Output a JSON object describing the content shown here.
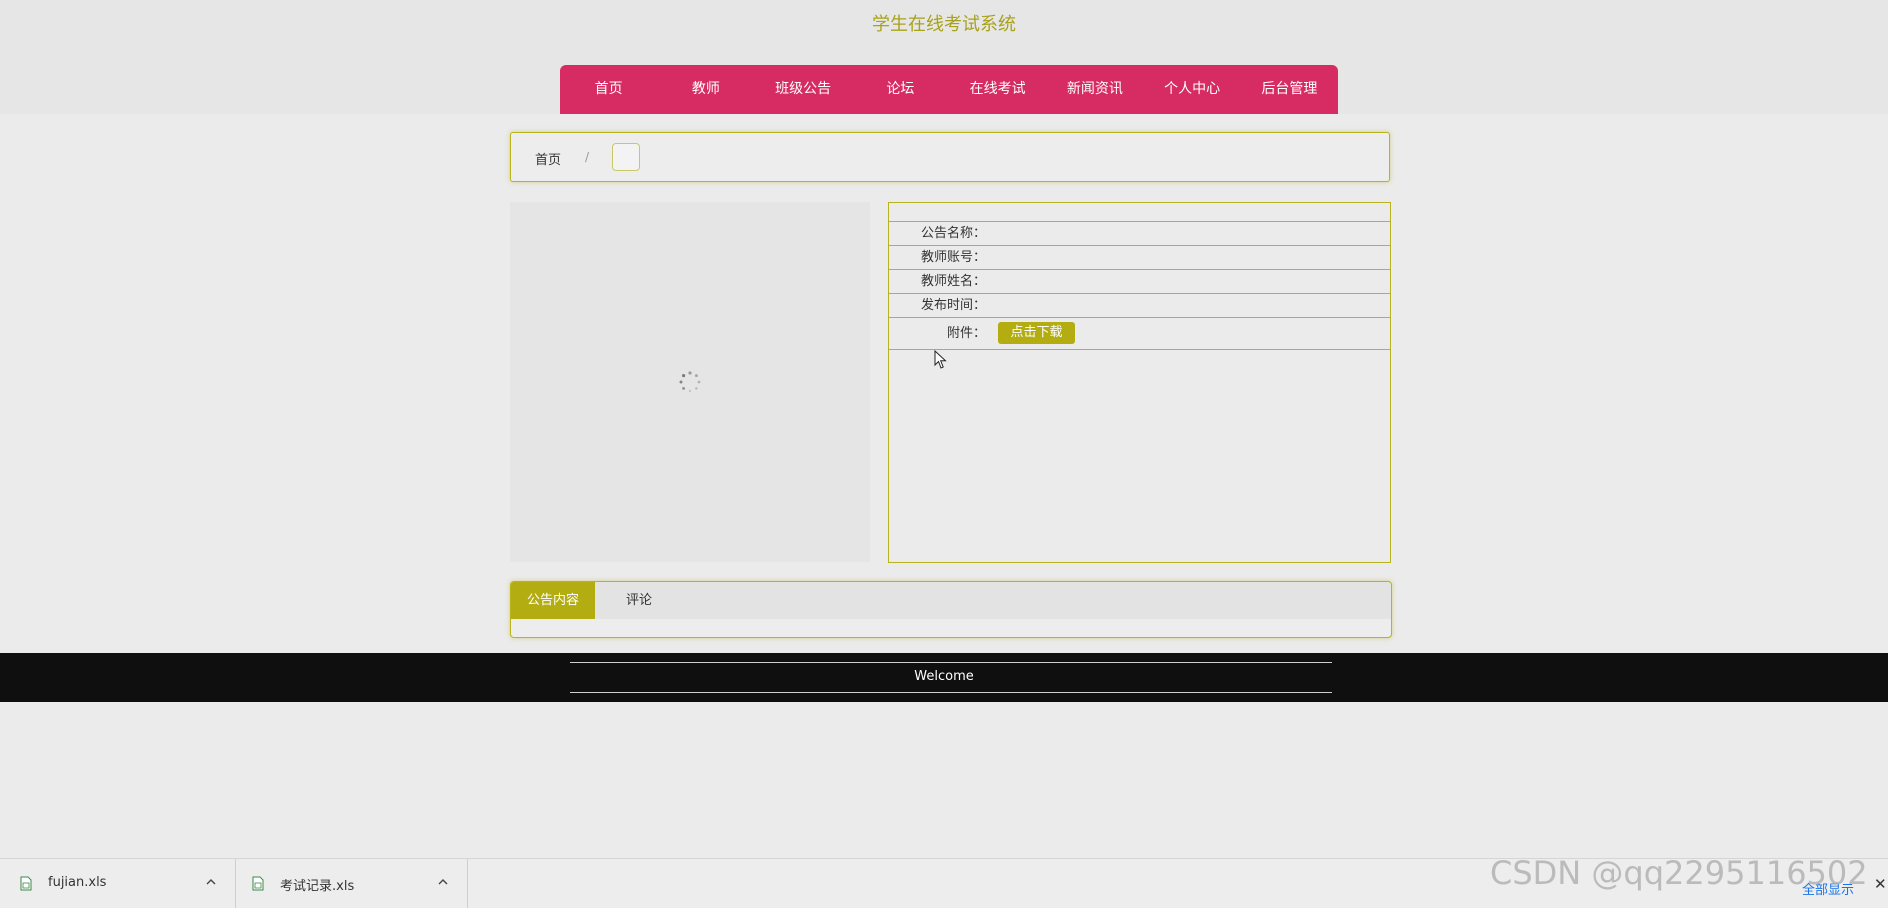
{
  "header": {
    "title": "学生在线考试系统"
  },
  "nav": {
    "items": [
      {
        "label": "首页"
      },
      {
        "label": "教师"
      },
      {
        "label": "班级公告"
      },
      {
        "label": "论坛"
      },
      {
        "label": "在线考试"
      },
      {
        "label": "新闻资讯"
      },
      {
        "label": "个人中心"
      },
      {
        "label": "后台管理"
      }
    ]
  },
  "breadcrumb": {
    "home": "首页",
    "separator": "/",
    "current": ""
  },
  "details": {
    "rows": [
      {
        "label": "公告名称：",
        "value": ""
      },
      {
        "label": "教师账号：",
        "value": ""
      },
      {
        "label": "教师姓名：",
        "value": ""
      },
      {
        "label": "发布时间：",
        "value": ""
      }
    ],
    "attachment_label": "附件：",
    "download_button": "点击下载"
  },
  "tabs": {
    "items": [
      {
        "label": "公告内容",
        "active": true
      },
      {
        "label": "评论",
        "active": false
      }
    ]
  },
  "footer": {
    "text": "Welcome"
  },
  "downloads": {
    "files": [
      {
        "name": "fujian.xls"
      },
      {
        "name": "考试记录.xls"
      }
    ],
    "show_all": "全部显示",
    "close": "✕"
  },
  "watermark": "CSDN @qq2295116502",
  "colors": {
    "accent": "#b3ad12",
    "nav": "#d62b63",
    "footer": "#0f0f0f"
  },
  "icons": [
    "loading-spinner-icon",
    "mouse-cursor-icon",
    "xls-file-icon",
    "chevron-up-icon",
    "close-icon"
  ]
}
